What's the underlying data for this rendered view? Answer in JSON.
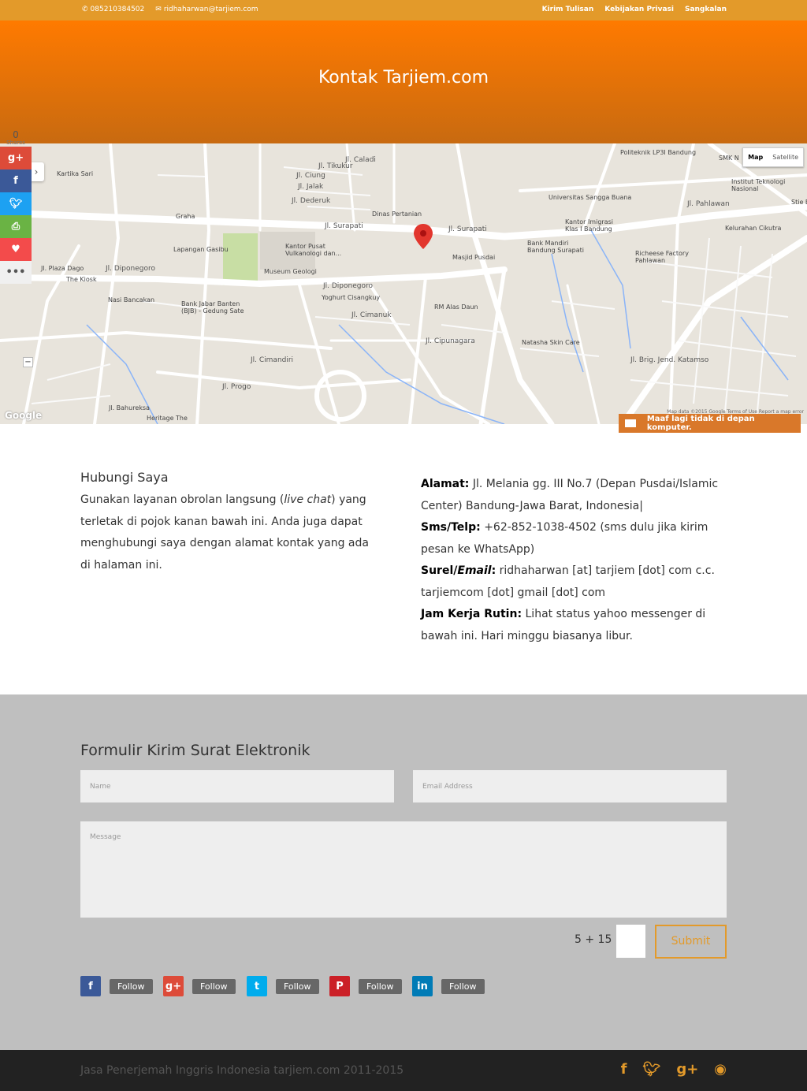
{
  "topbar": {
    "phone": "085210384502",
    "email": "ridhaharwan@tarjiem.com",
    "nav": [
      "Kirim Tulisan",
      "Kebijakan Privasi",
      "Sangkalan"
    ]
  },
  "header": {
    "title": "Kontak Tarjiem.com"
  },
  "map": {
    "type_map": "Map",
    "type_satellite": "Satellite",
    "google": "Google",
    "terms": "Map data ©2015 Google   Terms of Use   Report a map error",
    "labels": [
      "Kartika Sari",
      "Jl. Tikukur",
      "Jl. Caladi",
      "Jl. Ciung",
      "Jl. Jalak",
      "Jl. Dederuk",
      "Dinas Pertanian",
      "Graha",
      "Jl. Surapati",
      "Jl. Surapati",
      "Lapangan Gasibu",
      "Kantor Pusat Vulkanologi dan...",
      "Museum Geologi",
      "Masjid Pusdai",
      "Jl. Diponegoro",
      "Jl. Diponegoro",
      "Yoghurt Cisangkuy",
      "Nasi Bancakan",
      "Bank Jabar Banten (BJB) - Gedung Sate",
      "RM Alas Daun",
      "Jl. Cimanuk",
      "Jl. Cipunagara",
      "Natasha Skin Care",
      "Jl. Cimandiri",
      "Jl. Progo",
      "Jl. Bahureksa",
      "Heritage The",
      "Jl. Plaza Dago",
      "The Kiosk",
      "Politeknik LP3I Bandung",
      "SMK N",
      "Institut Teknologi Nasional",
      "Universitas Sangga Buana",
      "Kantor Imigrasi Klas I Bandung",
      "Bank Mandiri Bandung Surapati",
      "Kelurahan Cikutra",
      "Richeese Factory Pahlawan",
      "Jl. Pahlawan",
      "Jl. Brig. Jend. Katamso",
      "Stie E"
    ]
  },
  "share": {
    "count": "0",
    "count_label": "Shares",
    "buttons": [
      "g+",
      "f",
      "t",
      "print",
      "love",
      "more"
    ]
  },
  "chat": {
    "text": "Maaf lagi tidak di depan komputer."
  },
  "contact": {
    "heading": "Hubungi Saya",
    "intro_a": "Gunakan layanan obrolan langsung (",
    "intro_em": "live chat",
    "intro_b": ") yang terletak di pojok kanan bawah ini. Anda juga dapat menghubungi saya dengan alamat kontak yang ada di halaman ini.",
    "address_label": "Alamat:",
    "address": "Jl. Melania gg. III No.7 (Depan Pusdai/Islamic Center) Bandung-Jawa Barat, Indonesia|",
    "sms_label": "Sms/Telp:",
    "sms": "+62-852-1038-4502 (sms dulu jika kirim pesan ke WhatsApp)",
    "surel_label": "Surel/",
    "surel_em": "Email",
    "surel_colon": ":",
    "surel": "ridhaharwan [at] tarjiem [dot] com c.c. tarjiemcom [dot] gmail [dot] com",
    "jam_label": "Jam Kerja Rutin:",
    "jam": "Lihat status yahoo messenger di bawah ini. Hari minggu biasanya libur."
  },
  "form": {
    "title": "Formulir Kirim Surat Elektronik",
    "name_placeholder": "Name",
    "email_placeholder": "Email Address",
    "message_placeholder": "Message",
    "captcha": "5 + 15 =",
    "submit": "Submit"
  },
  "follow": [
    {
      "icon": "f",
      "label": "Follow",
      "color": "#3b5998"
    },
    {
      "icon": "g+",
      "label": "Follow",
      "color": "#dd4b39"
    },
    {
      "icon": "t",
      "label": "Follow",
      "color": "#00aced"
    },
    {
      "icon": "P",
      "label": "Follow",
      "color": "#cb2027"
    },
    {
      "icon": "in",
      "label": "Follow",
      "color": "#007bb6"
    }
  ],
  "footer": {
    "copyright": "Jasa Penerjemah Inggris Indonesia tarjiem.com 2011-2015",
    "icons": [
      "facebook-icon",
      "twitter-icon",
      "google-plus-icon",
      "rss-icon"
    ]
  },
  "colors": {
    "accent": "#e39a2a",
    "header_top": "#ff7a00",
    "header_bottom": "#c86a10",
    "form_bg": "#bfbfbf",
    "footer_bg": "#222222"
  }
}
